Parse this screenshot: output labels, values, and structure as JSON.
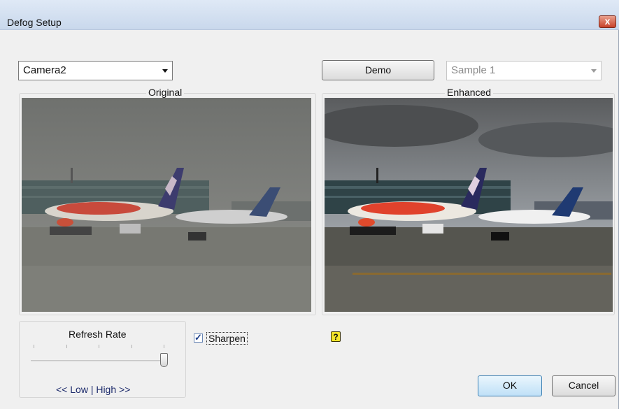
{
  "window": {
    "title": "Defog Setup",
    "close_symbol": "x"
  },
  "camera_select": {
    "value": "Camera2"
  },
  "demo_button": {
    "label": "Demo"
  },
  "sample_select": {
    "value": "Sample 1",
    "disabled": true
  },
  "panels": {
    "original_label": "Original",
    "enhanced_label": "Enhanced"
  },
  "refresh_rate": {
    "label": "Refresh Rate",
    "range_text": "<< Low | High >>",
    "slider_level_fraction": 1.0
  },
  "sharpen": {
    "label": "Sharpen",
    "checked": true,
    "check_glyph": "✓"
  },
  "help_icon": {
    "glyph": "?"
  },
  "buttons": {
    "ok": "OK",
    "cancel": "Cancel"
  },
  "colors": {
    "title_bar": "#c9d8ec",
    "close_button": "#c8412a",
    "help_icon": "#f4e52a",
    "dialog_bg": "#f0f0f0"
  },
  "icons": [
    "close-icon",
    "dropdown-arrow-icon",
    "checkmark-icon",
    "help-icon"
  ]
}
